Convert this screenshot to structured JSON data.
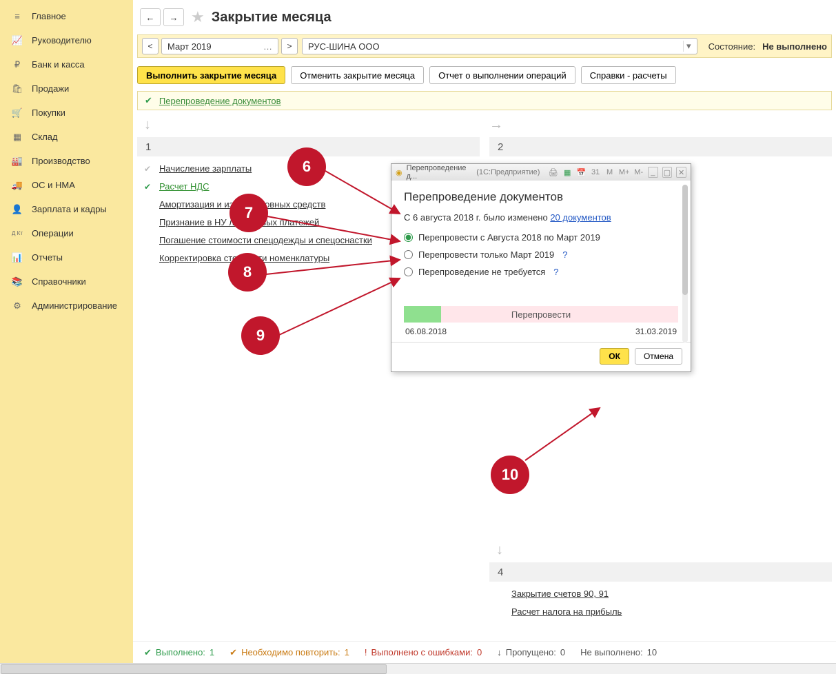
{
  "sidebar": {
    "items": [
      {
        "icon": "≡",
        "label": "Главное"
      },
      {
        "icon": "📈",
        "label": "Руководителю"
      },
      {
        "icon": "₽",
        "label": "Банк и касса"
      },
      {
        "icon": "🛍",
        "label": "Продажи"
      },
      {
        "icon": "🛒",
        "label": "Покупки"
      },
      {
        "icon": "▦",
        "label": "Склад"
      },
      {
        "icon": "🏭",
        "label": "Производство"
      },
      {
        "icon": "🚚",
        "label": "ОС и НМА"
      },
      {
        "icon": "👤",
        "label": "Зарплата и кадры"
      },
      {
        "icon": "Д Кт",
        "label": "Операции"
      },
      {
        "icon": "📊",
        "label": "Отчеты"
      },
      {
        "icon": "📚",
        "label": "Справочники"
      },
      {
        "icon": "⚙",
        "label": "Администрирование"
      }
    ]
  },
  "header": {
    "title": "Закрытие месяца"
  },
  "toolbar": {
    "month": "Март 2019",
    "org": "РУС-ШИНА ООО",
    "state_label": "Состояние:",
    "state_value": "Не выполнено"
  },
  "actions": {
    "run": "Выполнить закрытие месяца",
    "cancel": "Отменить закрытие месяца",
    "report": "Отчет о выполнении операций",
    "spravki": "Справки - расчеты"
  },
  "banner": {
    "link": "Перепроведение документов"
  },
  "col1": {
    "num": "1",
    "items": [
      {
        "label": "Начисление зарплаты",
        "status": "gray"
      },
      {
        "label": "Расчет НДС",
        "status": "green"
      },
      {
        "label": "Амортизация и износ основных средств",
        "status": ""
      },
      {
        "label": "Признание в НУ лизинговых платежей",
        "status": ""
      },
      {
        "label": "Погашение стоимости спецодежды и спецоснастки",
        "status": ""
      },
      {
        "label": "Корректировка стоимости номенклатуры",
        "status": ""
      }
    ]
  },
  "col2": {
    "num": "2"
  },
  "block4": {
    "num": "4",
    "items": [
      {
        "label": "Закрытие счетов 90, 91"
      },
      {
        "label": "Расчет налога на прибыль"
      }
    ]
  },
  "footer": {
    "done_label": "Выполнено:",
    "done_val": "1",
    "repeat_label": "Необходимо повторить:",
    "repeat_val": "1",
    "err_label": "Выполнено с ошибками:",
    "err_val": "0",
    "skip_label": "Пропущено:",
    "skip_val": "0",
    "not_label": "Не выполнено:",
    "not_val": "10"
  },
  "modal": {
    "wintitle": "Перепроведение д...",
    "appname": "(1С:Предприятие)",
    "heading": "Перепроведение документов",
    "text_pre": "С 6 августа 2018 г. было изменено ",
    "text_link": "20 документов",
    "opt1": "Перепровести с Августа 2018 по Март 2019",
    "opt2": "Перепровести только Март 2019",
    "opt3": "Перепроведение не требуется",
    "progress_label": "Перепровести",
    "date_from": "06.08.2018",
    "date_to": "31.03.2019",
    "ok": "ОК",
    "cancel": "Отмена",
    "ticons": {
      "m": "M",
      "mplus": "M+",
      "mminus": "M-"
    }
  },
  "callouts": {
    "c6": "6",
    "c7": "7",
    "c8": "8",
    "c9": "9",
    "c10": "10"
  }
}
